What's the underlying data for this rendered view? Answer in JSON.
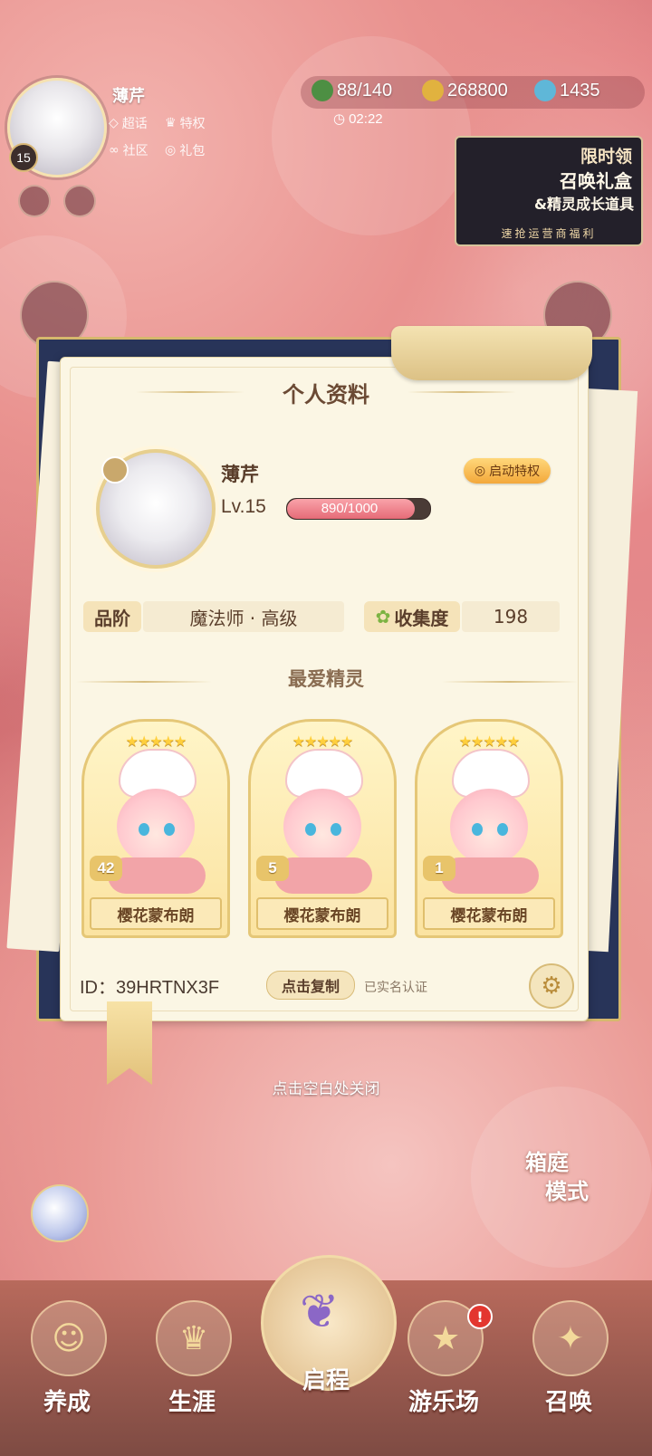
{
  "top": {
    "player_name": "薄芹",
    "level_badge": "15",
    "links": [
      "超话",
      "特权",
      "社区",
      "礼包"
    ],
    "stamina": "88/140",
    "gold": "268800",
    "gems": "1435",
    "timer": "02:22"
  },
  "promo": {
    "line1": "限时领",
    "line2": "召唤礼盒",
    "line3": "&精灵成长道具",
    "line4": "速抢运营商福利"
  },
  "profile": {
    "title": "个人资料",
    "name": "薄芹",
    "level": "Lv.15",
    "xp_text": "890/1000",
    "xp_fraction": 0.89,
    "privilege_button": "启动特权",
    "rank_label": "品阶",
    "rank_value": "魔法师 · 高级",
    "collection_label": "收集度",
    "collection_value": "198",
    "favorite_title": "最爱精灵",
    "favorites": [
      {
        "name": "樱花蒙布朗",
        "level": "42",
        "stars": "★★★★★"
      },
      {
        "name": "樱花蒙布朗",
        "level": "5",
        "stars": "★★★★★"
      },
      {
        "name": "樱花蒙布朗",
        "level": "1",
        "stars": "★★★★★"
      }
    ],
    "id_text": "ID：39HRTNX3F",
    "copy_button": "点击复制",
    "verified": "已实名认证"
  },
  "close_hint": "点击空白处关闭",
  "courtyard": {
    "line1": "箱庭",
    "line2": "模式"
  },
  "nav": {
    "items": [
      "养成",
      "生涯",
      "启程",
      "游乐场",
      "召唤"
    ],
    "notification": "!"
  },
  "colors": {
    "accent_gold": "#e5c777",
    "panel_bg": "#fbf6e4",
    "xp_fill": "#e66b77"
  }
}
